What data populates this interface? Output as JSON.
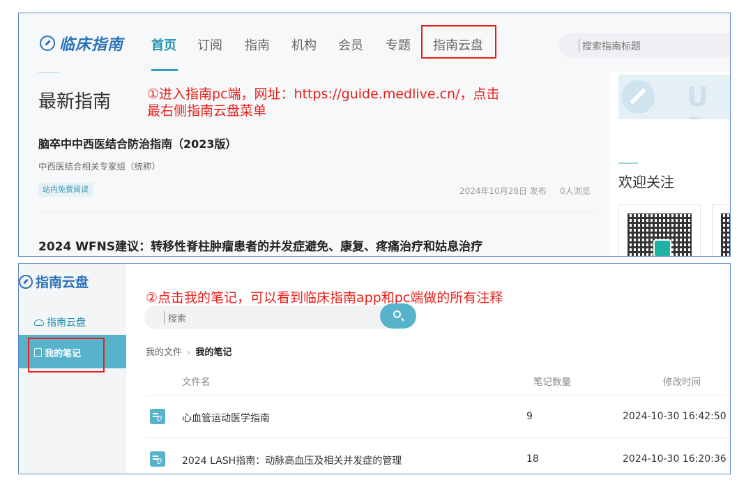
{
  "panel1": {
    "logo_text": "临床指南",
    "nav": [
      "首页",
      "订阅",
      "指南",
      "机构",
      "会员",
      "专题",
      "指南云盘"
    ],
    "search_placeholder": "搜索指南标题",
    "section_title": "最新指南",
    "annotation_line1": "①进入指南pc端，网址：https://guide.medlive.cn/，点击",
    "annotation_line2": "最右侧指南云盘菜单",
    "article1": {
      "title": "脑卒中中西医结合防治指南（2023版）",
      "author": "中西医结合相关专家组（统称）",
      "badge": "站内免费阅读",
      "date": "2024年10月28日 发布",
      "views": "0人浏览"
    },
    "article2_title": "2024 WFNS建议：转移性脊柱肿瘤患者的并发症避免、康复、疼痛治疗和姑息治疗",
    "side": {
      "banner_text": "U P",
      "follow_title": "欢迎关注"
    }
  },
  "panel2": {
    "logo_text": "指南云盘",
    "sidebar": [
      "指南云盘",
      "我的笔记"
    ],
    "annotation": "②点击我的笔记，可以看到临床指南app和pc端做的所有注释",
    "search_placeholder": "搜索",
    "breadcrumb": {
      "root": "我的文件",
      "sep": "›",
      "current": "我的笔记"
    },
    "columns": [
      "文件名",
      "笔记数量",
      "修改时间"
    ],
    "rows": [
      {
        "name": "心血管运动医学指南",
        "count": "9",
        "modified": "2024-10-30 16:42:50"
      },
      {
        "name": "2024 LASH指南：动脉高血压及相关并发症的管理",
        "count": "18",
        "modified": "2024-10-30 16:20:36"
      }
    ]
  },
  "colors": {
    "accent": "#56b3ca",
    "annotation": "#e8201a",
    "brand": "#2b73b8"
  }
}
